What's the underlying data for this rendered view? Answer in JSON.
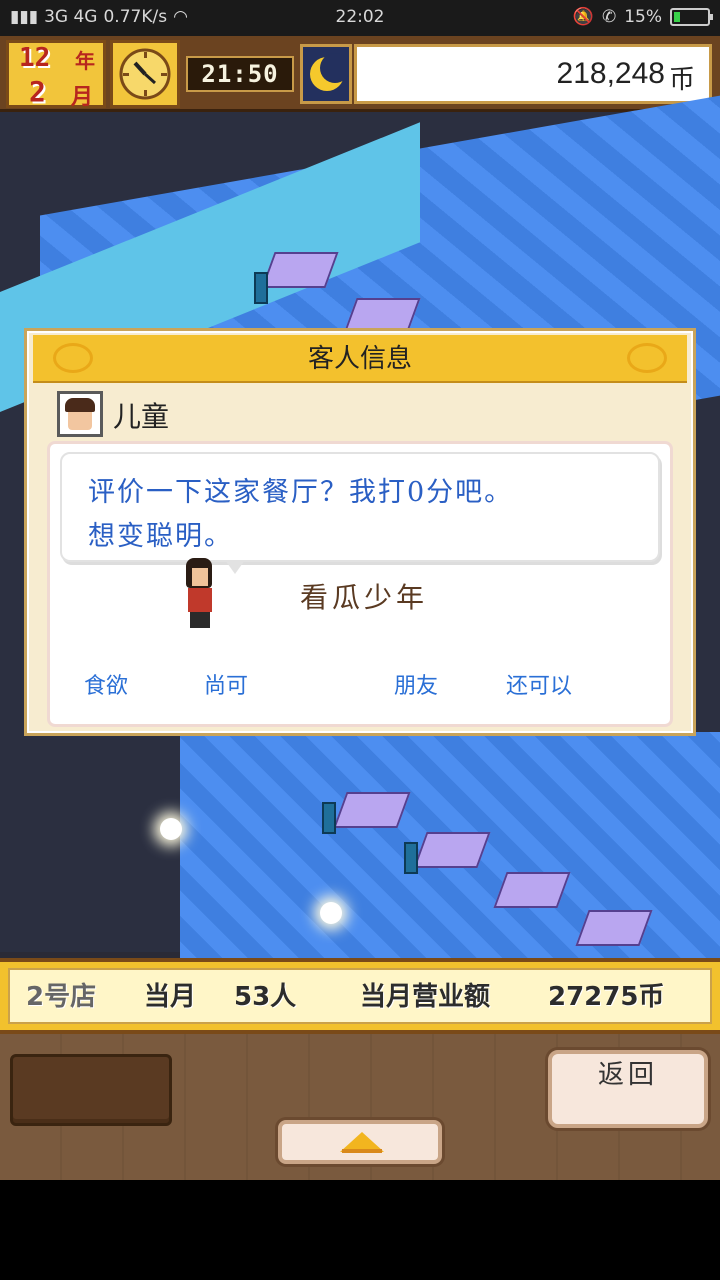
{
  "status_bar": {
    "network": "3G 4G",
    "speed": "0.77K/s",
    "time": "22:02",
    "battery": "15%"
  },
  "hud": {
    "year": "12",
    "year_unit": "年",
    "month": "2",
    "month_unit": "月",
    "game_time": "21:50",
    "money": "218,248",
    "money_unit": "币"
  },
  "dialog": {
    "title": "客人信息",
    "customer_type": "儿童",
    "comment_line1": "评价一下这家餐厅？我打0分吧。",
    "comment_line2": "想变聪明。",
    "nickname": "看瓜少年",
    "attributes": [
      {
        "label": "食欲"
      },
      {
        "label": "尚可"
      },
      {
        "label": "朋友"
      },
      {
        "label": "还可以"
      }
    ]
  },
  "stats_bar": {
    "shop": "2号店",
    "month_label": "当月",
    "customers": "53人",
    "revenue_label": "当月营业额",
    "revenue": "27275币"
  },
  "controls": {
    "back_label": "返回"
  },
  "colors": {
    "accent_gold": "#f3c12d",
    "text_blue": "#2a5fc4",
    "frame_brown": "#7a4a18"
  }
}
